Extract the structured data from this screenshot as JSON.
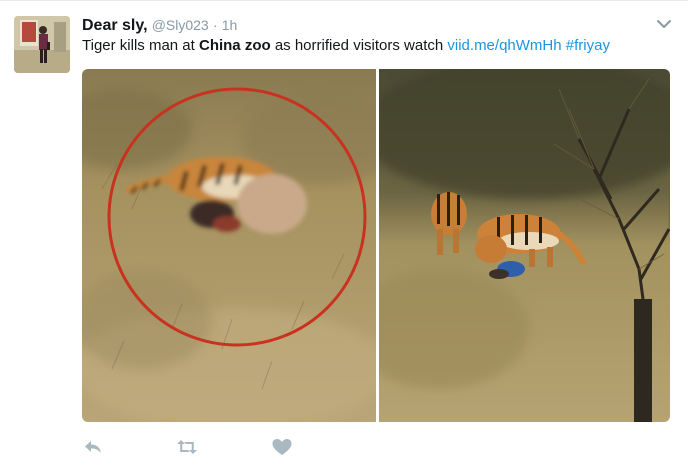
{
  "tweet": {
    "author_name": "Dear sly,",
    "handle": "@Sly023",
    "separator": "·",
    "time": "1h",
    "text_parts": {
      "p1": "Tiger kills man at ",
      "p2": "China",
      "p3": " ",
      "p4": "zoo",
      "p5": " as horrified visitors watch ",
      "link": "viid.me/qhWmHh",
      "p6": " ",
      "hashtag": "#friyay"
    }
  },
  "icons": {
    "caret": "chevron-down-icon",
    "reply": "reply-icon",
    "retweet": "retweet-icon",
    "like": "heart-icon"
  },
  "colors": {
    "link": "#1b95e0",
    "muted": "#8899a6",
    "annotation_circle": "#c8321e"
  }
}
